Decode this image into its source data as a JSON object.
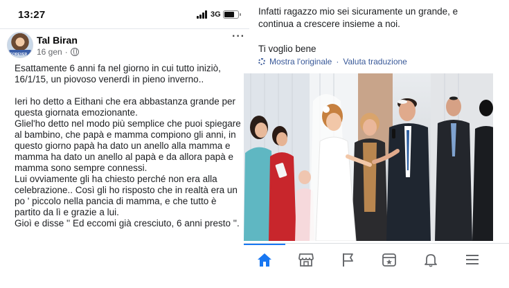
{
  "status": {
    "time": "13:27",
    "network": "3G"
  },
  "post": {
    "author": "Tal Biran",
    "age": "16 gen",
    "dot": "·",
    "more_label": "···",
    "avatar_caption": "FOREVER",
    "body": "Esattamente 6 anni fa nel giorno in cui tutto iniziò,\n16/1/15, un piovoso venerdì in pieno inverno..\n\nIeri ho detto a Eithani che era abbastanza grande per\nquesta giornata emozionante.\nGliel'ho detto nel modo più semplice che puoi spiegare\nal bambino, che papà e mamma compiono gli anni, in\nquesto giorno papà ha dato un anello alla mamma e\nmamma ha dato un anello al papà e da allora papà e\nmamma sono sempre connessi.\nLui ovviamente gli ha chiesto perché non era alla\ncelebrazione.. Così gli ho risposto che in realtà era un\npo ' piccolo nella pancia di mamma, e che tutto è\npartito da lì e grazie a lui.\nGioì e disse '' Ed eccomi già cresciuto, 6 anni presto ''.",
    "body_cont": "Infatti ragazzo mio sei sicuramente un grande, e\ncontinua a crescere insieme a noi.\n\nTi voglio bene",
    "translate": {
      "show_original": "Mostra l'originale",
      "separator": "·",
      "rate": "Valuta traduzione"
    }
  },
  "nav": {
    "items": [
      {
        "name": "home-icon",
        "active": true
      },
      {
        "name": "marketplace-icon",
        "active": false
      },
      {
        "name": "pages-flag-icon",
        "active": false
      },
      {
        "name": "events-icon",
        "active": false
      },
      {
        "name": "notifications-bell-icon",
        "active": false
      },
      {
        "name": "menu-icon",
        "active": false
      }
    ],
    "accent": "#1877f2",
    "icon_color": "#65676b"
  }
}
